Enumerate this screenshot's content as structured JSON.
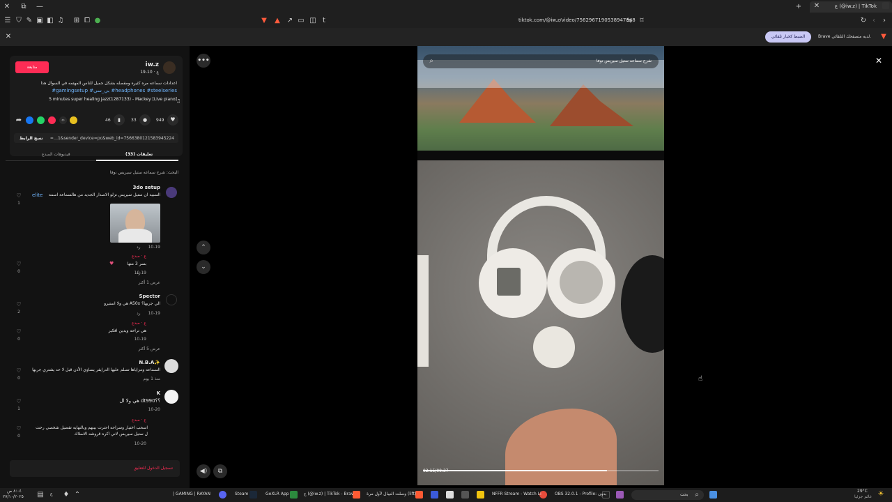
{
  "browser": {
    "tab_title": "ع (@iw.z) | TikTok",
    "url": "tiktok.com/@iw.z/video/7562967190538947848",
    "banner_text": "Brave لديه متصفحك التلقائي.",
    "banner_button": "الضبط كخيار تلقائي",
    "top_right_hint": "تحميل الإدارة"
  },
  "post": {
    "username": "iw.z",
    "date": "ع · 10-19",
    "follow_label": "متابعة",
    "caption": "اعدادات سماعه مره كثيره ومفصله بشكل جميل للناس المهتمه في السوال هذا",
    "hashtags": "#gamingsetup #بي_سي #headphones #steelseries",
    "music": "5 minutes super healing jazz(1287133) - Mackey [Live piano]",
    "likes": "949",
    "comments": "33",
    "saves": "46",
    "link_text": "=…1&sender_device=pc&web_id=7566380121583945224",
    "copy_link": "نسخ الرابط"
  },
  "tabs": {
    "comments_tab": "تعليقات (33)",
    "creator_videos_tab": "فيديوهات المبدع"
  },
  "search_hint": "البحث: شرح سماعه ستيل سيريس نوفا",
  "comments": [
    {
      "user": "3do setup",
      "text": "السبيه ان ستيل سيريس نزلو الاصدار الجديد من هالسماعة اسمه",
      "tag": "elite",
      "date": "10-19",
      "reply": "رد",
      "likes": "1"
    },
    {
      "user": "ع · مبدع",
      "text": "بسر 3 منها",
      "date": "10-19",
      "reply": "رد",
      "likes": "0",
      "more": "عرض 1 أكثر"
    },
    {
      "user": "Spector",
      "text": "هي ولا استيرو A50x الي جربها؟",
      "date": "10-19",
      "reply": "رد",
      "likes": "2"
    },
    {
      "user": "ع · مبدع",
      "text": "هي تراحه ويدين افكير",
      "date": "10-19",
      "reply": "رد",
      "likes": "0",
      "more": "عرض 5 أكثر"
    },
    {
      "user": "N.B.A✨",
      "text": "السماعه ومزاياها تسلم عليها الدرايفر يساوي الأذن قبل لا حد يشتري جربها",
      "date": "منذ 1 يوم",
      "reply": "رد",
      "likes": "0"
    },
    {
      "user": "K",
      "text": "هي ولا ال dt990؟؟",
      "date": "10-20",
      "reply": "رد",
      "likes": "1"
    },
    {
      "user": "ع · مبدع",
      "text": "اسحب اختيار وسراحه احترت بينهم وبالنهايه تفضيل شخصي رحت ل ستيل سيريس لاني اكره قروشه الاسلاك",
      "date": "10-20",
      "reply": "رد",
      "likes": "0"
    }
  ],
  "login_prompt": "تسجيل الدخول للتعليق",
  "video": {
    "search_overlay": "شرح سماعه ستيل سيريس نوفا",
    "time": "02:15/00:37",
    "progress": 0.78
  },
  "taskbar": {
    "search_label": "بحث",
    "items": [
      "ع (@iw.z) | TikTok - Brav",
      "وصلت النيبال لأول مرة (lift)",
      "NFFR Stream - Watch Li",
      "OBS 32.0.1 - Profile: بدون",
      "GoXLR App",
      "Steam",
      "| GAMING | RAYAN"
    ],
    "clock": "٨:٠٤ ص",
    "date": "٢٧/١٠/٢٠٢٥",
    "weather": "29°C",
    "weather_desc": "غائم جزئيا",
    "lang": "ع"
  },
  "colors": {
    "accent": "#fe2c55",
    "link": "#70b6ff",
    "pill": "#c9c8f5"
  }
}
